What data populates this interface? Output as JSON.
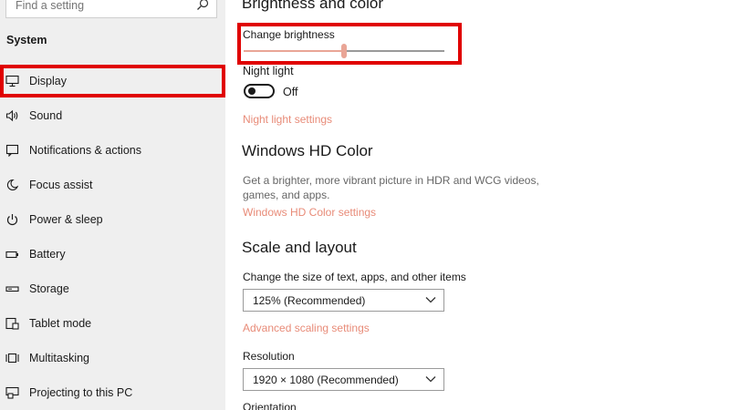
{
  "search": {
    "placeholder": "Find a setting",
    "icon": "search-icon"
  },
  "sidebar": {
    "section_title": "System",
    "items": [
      {
        "label": "Display",
        "icon": "monitor-icon",
        "selected": true
      },
      {
        "label": "Sound",
        "icon": "speaker-icon"
      },
      {
        "label": "Notifications & actions",
        "icon": "notification-icon"
      },
      {
        "label": "Focus assist",
        "icon": "moon-icon"
      },
      {
        "label": "Power & sleep",
        "icon": "power-icon"
      },
      {
        "label": "Battery",
        "icon": "battery-icon"
      },
      {
        "label": "Storage",
        "icon": "storage-icon"
      },
      {
        "label": "Tablet mode",
        "icon": "tablet-icon"
      },
      {
        "label": "Multitasking",
        "icon": "multitasking-icon"
      },
      {
        "label": "Projecting to this PC",
        "icon": "projecting-icon"
      }
    ]
  },
  "main": {
    "brightness_section_title": "Brightness and color",
    "brightness": {
      "label": "Change brightness",
      "value": 0.5
    },
    "night_light": {
      "label": "Night light",
      "state_label": "Off",
      "on": false,
      "settings_link": "Night light settings"
    },
    "hd_color": {
      "title": "Windows HD Color",
      "description": "Get a brighter, more vibrant picture in HDR and WCG videos, games, and apps.",
      "settings_link": "Windows HD Color settings"
    },
    "scale_layout": {
      "title": "Scale and layout",
      "size_label": "Change the size of text, apps, and other items",
      "size_value": "125% (Recommended)",
      "advanced_link": "Advanced scaling settings",
      "resolution_label": "Resolution",
      "resolution_value": "1920 × 1080 (Recommended)",
      "orientation_label": "Orientation"
    }
  },
  "colors": {
    "accent_link": "#e88b78",
    "slider_accent": "#e9a596",
    "highlight_border": "#e00000",
    "sidebar_bg": "#efefef"
  }
}
